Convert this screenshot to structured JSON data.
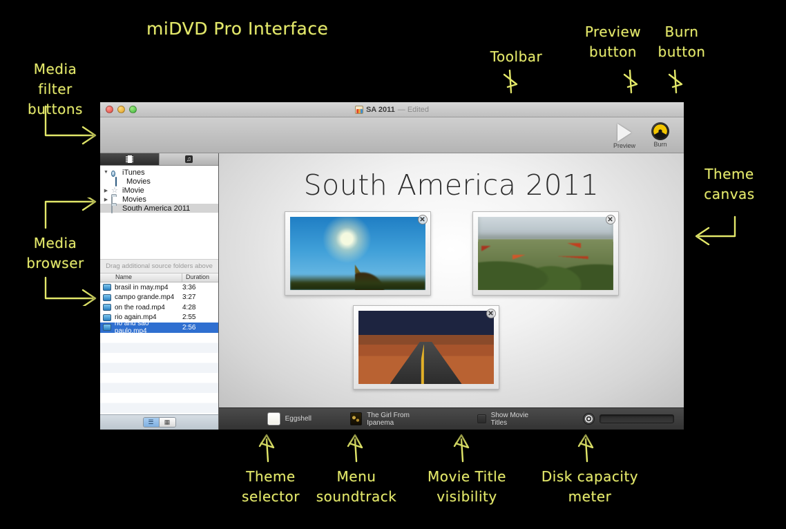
{
  "annotations": {
    "title": "miDVD Pro Interface",
    "media_filter": "Media\nfilter\nbuttons",
    "media_browser": "Media\nbrowser",
    "toolbar": "Toolbar",
    "preview_button": "Preview\nbutton",
    "burn_button": "Burn\nbutton",
    "theme_canvas": "Theme\ncanvas",
    "theme_selector": "Theme\nselector",
    "menu_soundtrack": "Menu\nsoundtrack",
    "movie_title_visibility": "Movie Title\nvisibility",
    "disk_capacity_meter": "Disk capacity\nmeter"
  },
  "window": {
    "title_name": "SA 2011",
    "title_status": "— Edited",
    "doc_icon": "dvd-document-icon",
    "traffic_lights": [
      "close-light",
      "minimize-light",
      "maximize-light"
    ]
  },
  "toolbar": {
    "buttons": [
      {
        "label": "Preview",
        "icon": "play-triangle-icon"
      },
      {
        "label": "Burn",
        "icon": "radiation-burn-icon"
      }
    ]
  },
  "sidebar": {
    "media_tabs": [
      {
        "name": "video-tab",
        "icon": "film-strip-icon",
        "active": true
      },
      {
        "name": "audio-tab",
        "icon": "music-note-icon",
        "active": false
      }
    ],
    "tree": [
      {
        "label": "iTunes",
        "icon": "itunes-icon",
        "indent": 0,
        "disclosure": "▼",
        "selected": false
      },
      {
        "label": "Movies",
        "icon": "monitor-icon",
        "indent": 1,
        "disclosure": "",
        "selected": false
      },
      {
        "label": "iMovie",
        "icon": "star-icon",
        "indent": 0,
        "disclosure": "▶",
        "selected": false
      },
      {
        "label": "Movies",
        "icon": "folder-icon",
        "indent": 0,
        "disclosure": "▶",
        "selected": false
      },
      {
        "label": "South America 2011",
        "icon": "folder-icon",
        "indent": 0,
        "disclosure": "",
        "selected": true
      }
    ],
    "drag_hint": "Drag additional source folders above",
    "file_list": {
      "columns": [
        "Name",
        "Duration"
      ],
      "rows": [
        {
          "name": "brasil in may.mp4",
          "duration": "3:36",
          "selected": false
        },
        {
          "name": "campo grande.mp4",
          "duration": "3:27",
          "selected": false
        },
        {
          "name": "on the road.mp4",
          "duration": "4:28",
          "selected": false
        },
        {
          "name": "rio again.mp4",
          "duration": "2:55",
          "selected": false
        },
        {
          "name": "rio and sao paulo.mp4",
          "duration": "2:56",
          "selected": true
        }
      ]
    },
    "view_toggle": [
      {
        "name": "list-view",
        "icon": "list-icon",
        "active": true
      },
      {
        "name": "grid-view",
        "icon": "grid-icon",
        "active": false
      }
    ]
  },
  "canvas": {
    "menu_title": "South America 2011",
    "thumbnails": [
      {
        "name": "palm-tree-thumbnail",
        "art": "art-palm",
        "delete_label": "✕"
      },
      {
        "name": "temple-rooftops-thumbnail",
        "art": "art-temple",
        "delete_label": "✕"
      },
      {
        "name": "desert-road-thumbnail",
        "art": "art-road",
        "delete_label": "✕"
      }
    ]
  },
  "bottom_bar": {
    "theme_label": "Eggshell",
    "soundtrack_label": "The Girl From Ipanema",
    "movie_titles_label": "Show Movie Titles",
    "movie_titles_checked": false,
    "capacity_percent": 9
  },
  "colors": {
    "annotation": "#e3e86a",
    "selection": "#2f6fd0",
    "burn_yellow": "#f2c500"
  }
}
